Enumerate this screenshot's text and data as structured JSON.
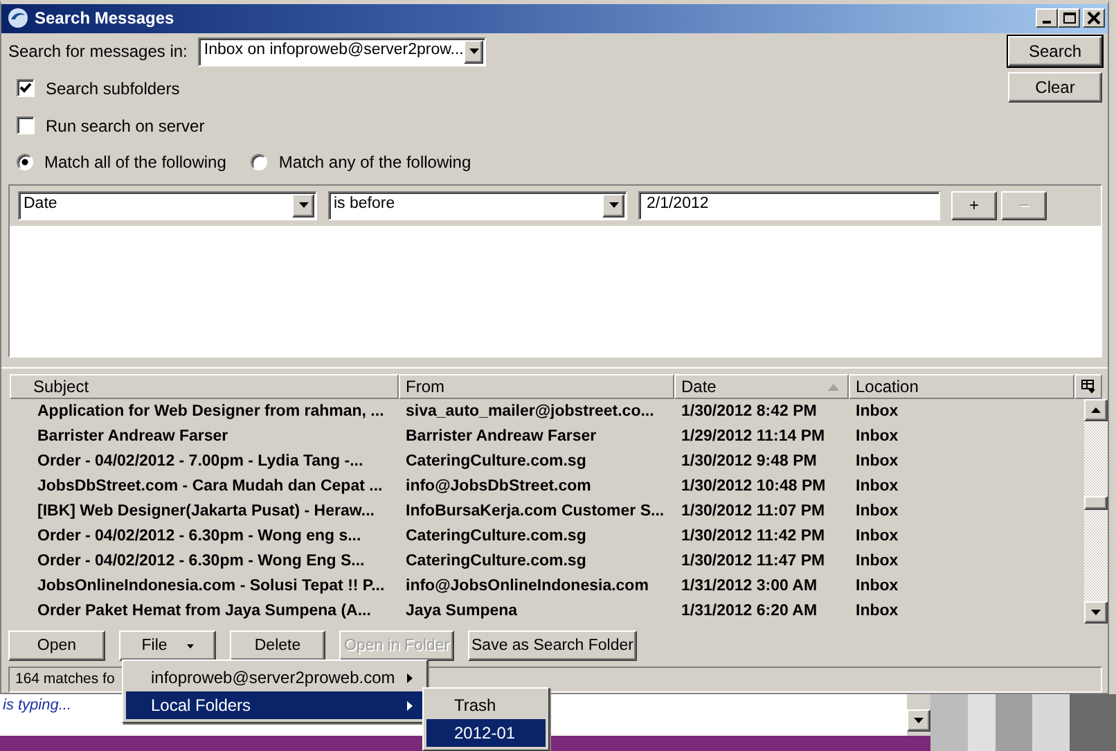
{
  "window": {
    "title": "Search Messages"
  },
  "scope": {
    "label": "Search for messages in:",
    "value": "Inbox on infoproweb@server2prow..."
  },
  "options": [
    {
      "label": "Search subfolders",
      "checked": true
    },
    {
      "label": "Run search on server",
      "checked": false
    }
  ],
  "match_modes": [
    {
      "label": "Match all of the following",
      "selected": true
    },
    {
      "label": "Match any of the following",
      "selected": false
    }
  ],
  "action_buttons": [
    "Search",
    "Clear"
  ],
  "criteria": [
    {
      "field": "Date",
      "operator": "is before",
      "value": "2/1/2012"
    }
  ],
  "criteria_buttons": [
    {
      "label": "+",
      "disabled": false
    },
    {
      "label": "−",
      "disabled": true
    }
  ],
  "table": {
    "columns": [
      {
        "label": "Subject",
        "sorted": false
      },
      {
        "label": "From",
        "sorted": false
      },
      {
        "label": "Date",
        "sorted": true
      },
      {
        "label": "Location",
        "sorted": false
      }
    ],
    "rows": [
      [
        "Application for Web Designer from rahman, ...",
        "siva_auto_mailer@jobstreet.co...",
        "1/30/2012 8:42 PM",
        "Inbox"
      ],
      [
        "Barrister Andreaw Farser",
        "Barrister Andreaw Farser",
        "1/29/2012 11:14 PM",
        "Inbox"
      ],
      [
        "Order - 04/02/2012 - 7.00pm - Lydia Tang -...",
        "CateringCulture.com.sg",
        "1/30/2012 9:48 PM",
        "Inbox"
      ],
      [
        "JobsDbStreet.com - Cara Mudah dan Cepat ...",
        "info@JobsDbStreet.com",
        "1/30/2012 10:48 PM",
        "Inbox"
      ],
      [
        "[IBK] Web Designer(Jakarta Pusat) - Heraw...",
        "InfoBursaKerja.com Customer S...",
        "1/30/2012 11:07 PM",
        "Inbox"
      ],
      [
        "Order - 04/02/2012 - 6.30pm - Wong eng s...",
        "CateringCulture.com.sg",
        "1/30/2012 11:42 PM",
        "Inbox"
      ],
      [
        "Order - 04/02/2012 - 6.30pm - Wong Eng S...",
        "CateringCulture.com.sg",
        "1/30/2012 11:47 PM",
        "Inbox"
      ],
      [
        "JobsOnlineIndonesia.com - Solusi Tepat !! P...",
        "info@JobsOnlineIndonesia.com",
        "1/31/2012 3:00 AM",
        "Inbox"
      ],
      [
        "Order Paket Hemat from Jaya Sumpena (A...",
        "Jaya Sumpena",
        "1/31/2012 6:20 AM",
        "Inbox"
      ]
    ]
  },
  "bottom_buttons": [
    {
      "label": "Open",
      "disabled": false,
      "dropdown": false
    },
    {
      "label": "File",
      "disabled": false,
      "dropdown": true
    },
    {
      "label": "Delete",
      "disabled": false,
      "dropdown": false
    },
    {
      "label": "Open in Folder",
      "disabled": true,
      "dropdown": false
    },
    {
      "label": "Save as Search Folder",
      "disabled": false,
      "dropdown": false
    }
  ],
  "status_bar": "164 matches fo",
  "menu": [
    {
      "label": "infoproweb@server2proweb.com",
      "selected": false,
      "submenu": true
    },
    {
      "label": "Local Folders",
      "selected": true,
      "submenu": true
    }
  ],
  "submenu": [
    {
      "label": "Trash",
      "selected": false
    },
    {
      "label": "2012-01",
      "selected": true
    }
  ],
  "background": {
    "status": "is typing..."
  }
}
